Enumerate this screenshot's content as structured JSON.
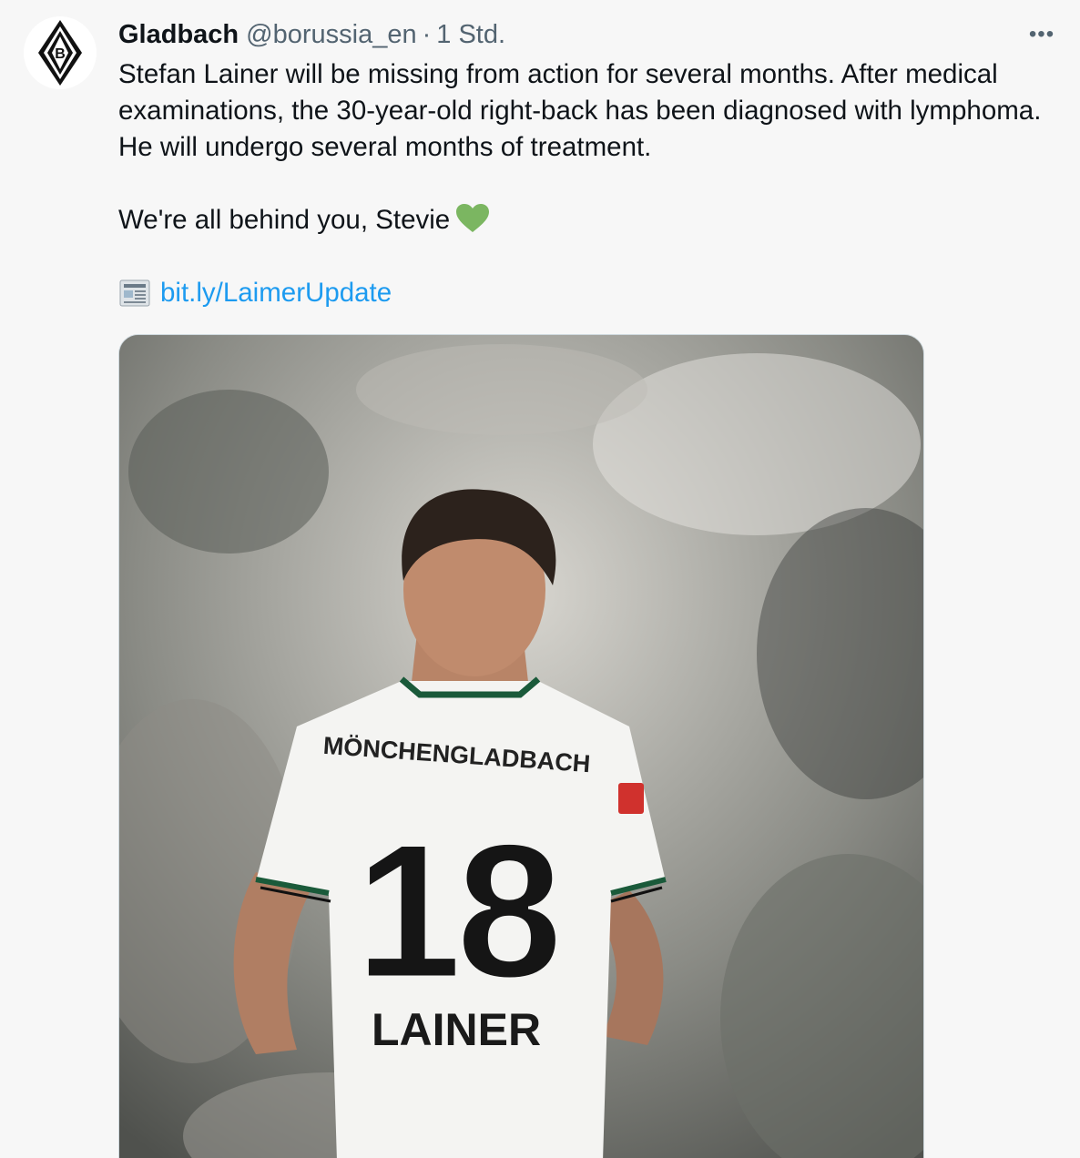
{
  "tweet": {
    "display_name": "Gladbach",
    "handle": "@borussia_en",
    "separator": "·",
    "time": "1 Std.",
    "more_label": "•••",
    "text_p1": "Stefan Lainer will be missing from action for several months. After medical examinations, the 30-year-old right-back has been diagnosed with lymphoma. He will undergo several months of treatment.",
    "text_p2": "We're all behind you, Stevie",
    "link_text": "bit.ly/LaimerUpdate"
  },
  "media": {
    "jersey_club": "MÖNCHENGLADBACH",
    "jersey_number": "18",
    "jersey_name": "LAINER"
  },
  "colors": {
    "accent_link": "#1d9bf0",
    "text_primary": "#0f1419",
    "text_secondary": "#536471",
    "heart": "#7bb661",
    "kit_green": "#1a5a3a"
  },
  "icons": {
    "avatar": "borussia-crest-icon",
    "more": "more-dots-icon",
    "heart": "green-heart-icon",
    "news": "newspaper-icon"
  }
}
